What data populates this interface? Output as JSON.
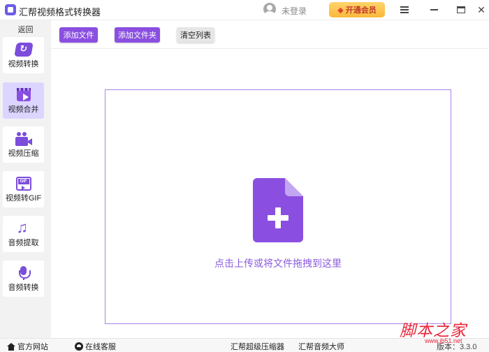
{
  "app": {
    "title": "汇帮视频格式转换器",
    "login_label": "未登录",
    "vip_label": "开通会员"
  },
  "sidebar": {
    "back_label": "返回",
    "items": [
      {
        "label": "视频转换",
        "icon": "video-convert-icon",
        "active": false
      },
      {
        "label": "视频合并",
        "icon": "video-merge-icon",
        "active": true
      },
      {
        "label": "视频压缩",
        "icon": "video-compress-icon",
        "active": false
      },
      {
        "label": "视频转GIF",
        "icon": "gif-icon",
        "active": false
      },
      {
        "label": "音频提取",
        "icon": "music-note-icon",
        "active": false
      },
      {
        "label": "音频转换",
        "icon": "microphone-icon",
        "active": false
      }
    ]
  },
  "toolbar": {
    "add_file_label": "添加文件",
    "add_folder_label": "添加文件夹",
    "clear_list_label": "清空列表"
  },
  "dropzone": {
    "hint": "点击上传或将文件拖拽到这里",
    "icon": "file-add-icon"
  },
  "statusbar": {
    "official_site_label": "官方网站",
    "online_support_label": "在线客服",
    "compressor_link": "汇帮超级压缩器",
    "audio_master_link": "汇帮音频大师",
    "version_text": "版本：3.3.0"
  },
  "watermark": {
    "main": "脚本之家",
    "sub": "www.jb51.net"
  },
  "colors": {
    "accent": "#8a4fe0",
    "sidebar_active": "#dcd5ff",
    "vip_gold": "#f9b93a",
    "watermark_red": "#e8263c"
  }
}
